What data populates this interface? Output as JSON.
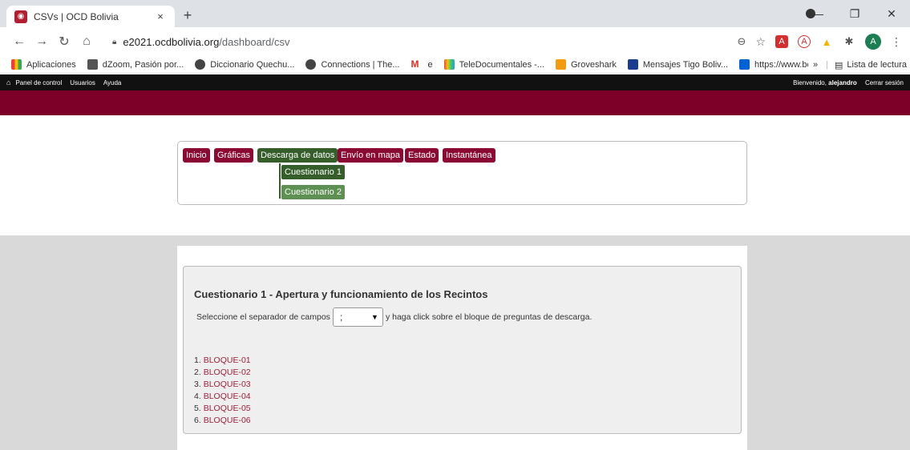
{
  "browser": {
    "tab_title": "CSVs | OCD Bolivia",
    "tab_close": "×",
    "new_tab": "+",
    "url_domain": "e2021.ocdbolivia.org",
    "url_path": "/dashboard/csv",
    "profile_initial": "A",
    "bookmarks": [
      {
        "label": "Aplicaciones",
        "color": "#f4b400"
      },
      {
        "label": "dZoom, Pasión por...",
        "color": "#555555"
      },
      {
        "label": "Diccionario Quechu...",
        "color": "#444444"
      },
      {
        "label": "Connections | The...",
        "color": "#444444"
      },
      {
        "label": "e",
        "color": "#d93025"
      },
      {
        "label": "TeleDocumentales -...",
        "color": "#8e44ad"
      },
      {
        "label": "Groveshark",
        "color": "#f39c12"
      },
      {
        "label": "Mensajes Tigo Boliv...",
        "color": "#1a3c8c"
      },
      {
        "label": "https://www.box.co...",
        "color": "#0061d5"
      }
    ],
    "reading_list": "Lista de lectura",
    "more": "»"
  },
  "adminbar": {
    "home": "Panel de control",
    "users": "Usuarios",
    "help": "Ayuda",
    "welcome_prefix": "Bienvenido, ",
    "username": "alejandro",
    "logout": "Cerrar sesión"
  },
  "menu": {
    "items": [
      "Inicio",
      "Gráficas",
      "Descarga de datos",
      "Envío en mapa",
      "Estado",
      "Instantánea"
    ],
    "submenu": [
      "Cuestionario 1",
      "Cuestionario 2"
    ]
  },
  "content": {
    "title": "Cuestionario 1 - Apertura y funcionamiento de los Recintos",
    "sep_label": "Seleccione el separador de campos",
    "sep_value": ";",
    "sep_suffix": "y haga click sobre el bloque de preguntas de descarga.",
    "blocks": [
      {
        "num": "1.",
        "label": "BLOQUE-01"
      },
      {
        "num": "2.",
        "label": "BLOQUE-02"
      },
      {
        "num": "3.",
        "label": "BLOQUE-03"
      },
      {
        "num": "4.",
        "label": "BLOQUE-04"
      },
      {
        "num": "5.",
        "label": "BLOQUE-05"
      },
      {
        "num": "6.",
        "label": "BLOQUE-06"
      }
    ]
  }
}
